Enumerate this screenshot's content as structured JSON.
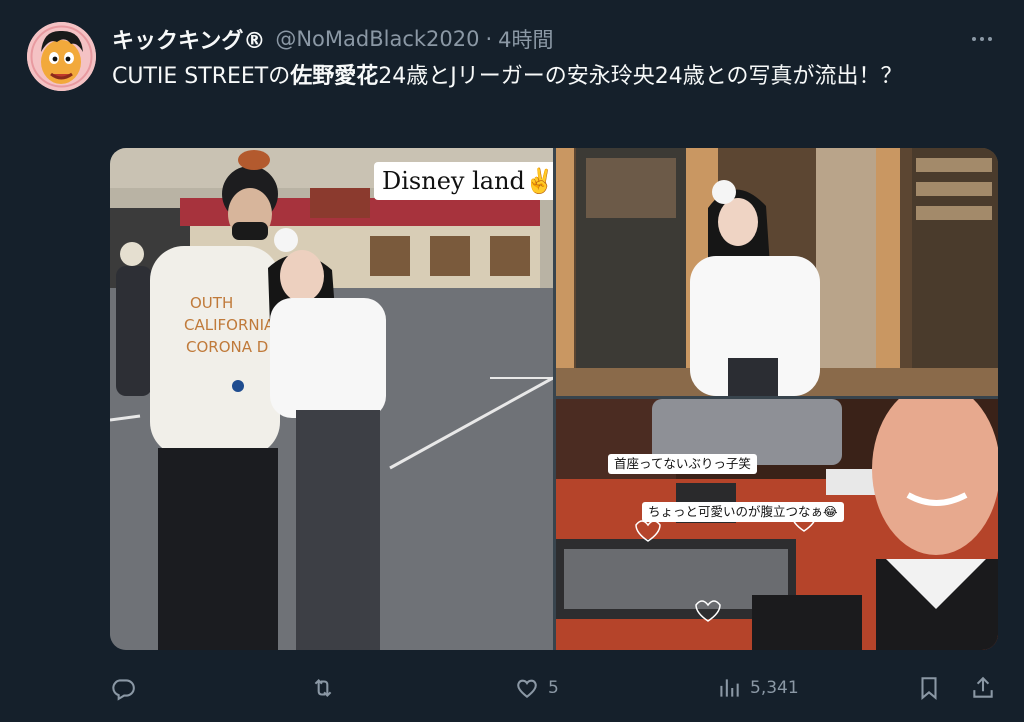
{
  "tweet": {
    "display_name": "キックキング®",
    "handle": "@NoMadBlack2020",
    "separator": "·",
    "time": "4時間",
    "text_part1": "CUTIE STREETの",
    "text_bold": "佐野愛花",
    "text_part2": "24歳とJリーガーの安永玲央24歳との写真が流出！？"
  },
  "media": {
    "photo1_caption": "Disney land✌✌",
    "photo3_caption_1": "首座ってないぶりっ子笑",
    "photo3_caption_2": "ちょっと可愛いのが腹立つなぁ😂"
  },
  "actions": {
    "reply_count": "",
    "retweet_count": "",
    "like_count": "5",
    "views_count": "5,341"
  },
  "icons": {
    "more": "more-horizontal-icon",
    "reply": "reply-icon",
    "retweet": "retweet-icon",
    "like": "heart-icon",
    "views": "views-chart-icon",
    "bookmark": "bookmark-icon",
    "share": "share-icon"
  },
  "colors": {
    "background": "#15202b",
    "text_primary": "#f7f9f9",
    "text_secondary": "#8b98a5"
  }
}
